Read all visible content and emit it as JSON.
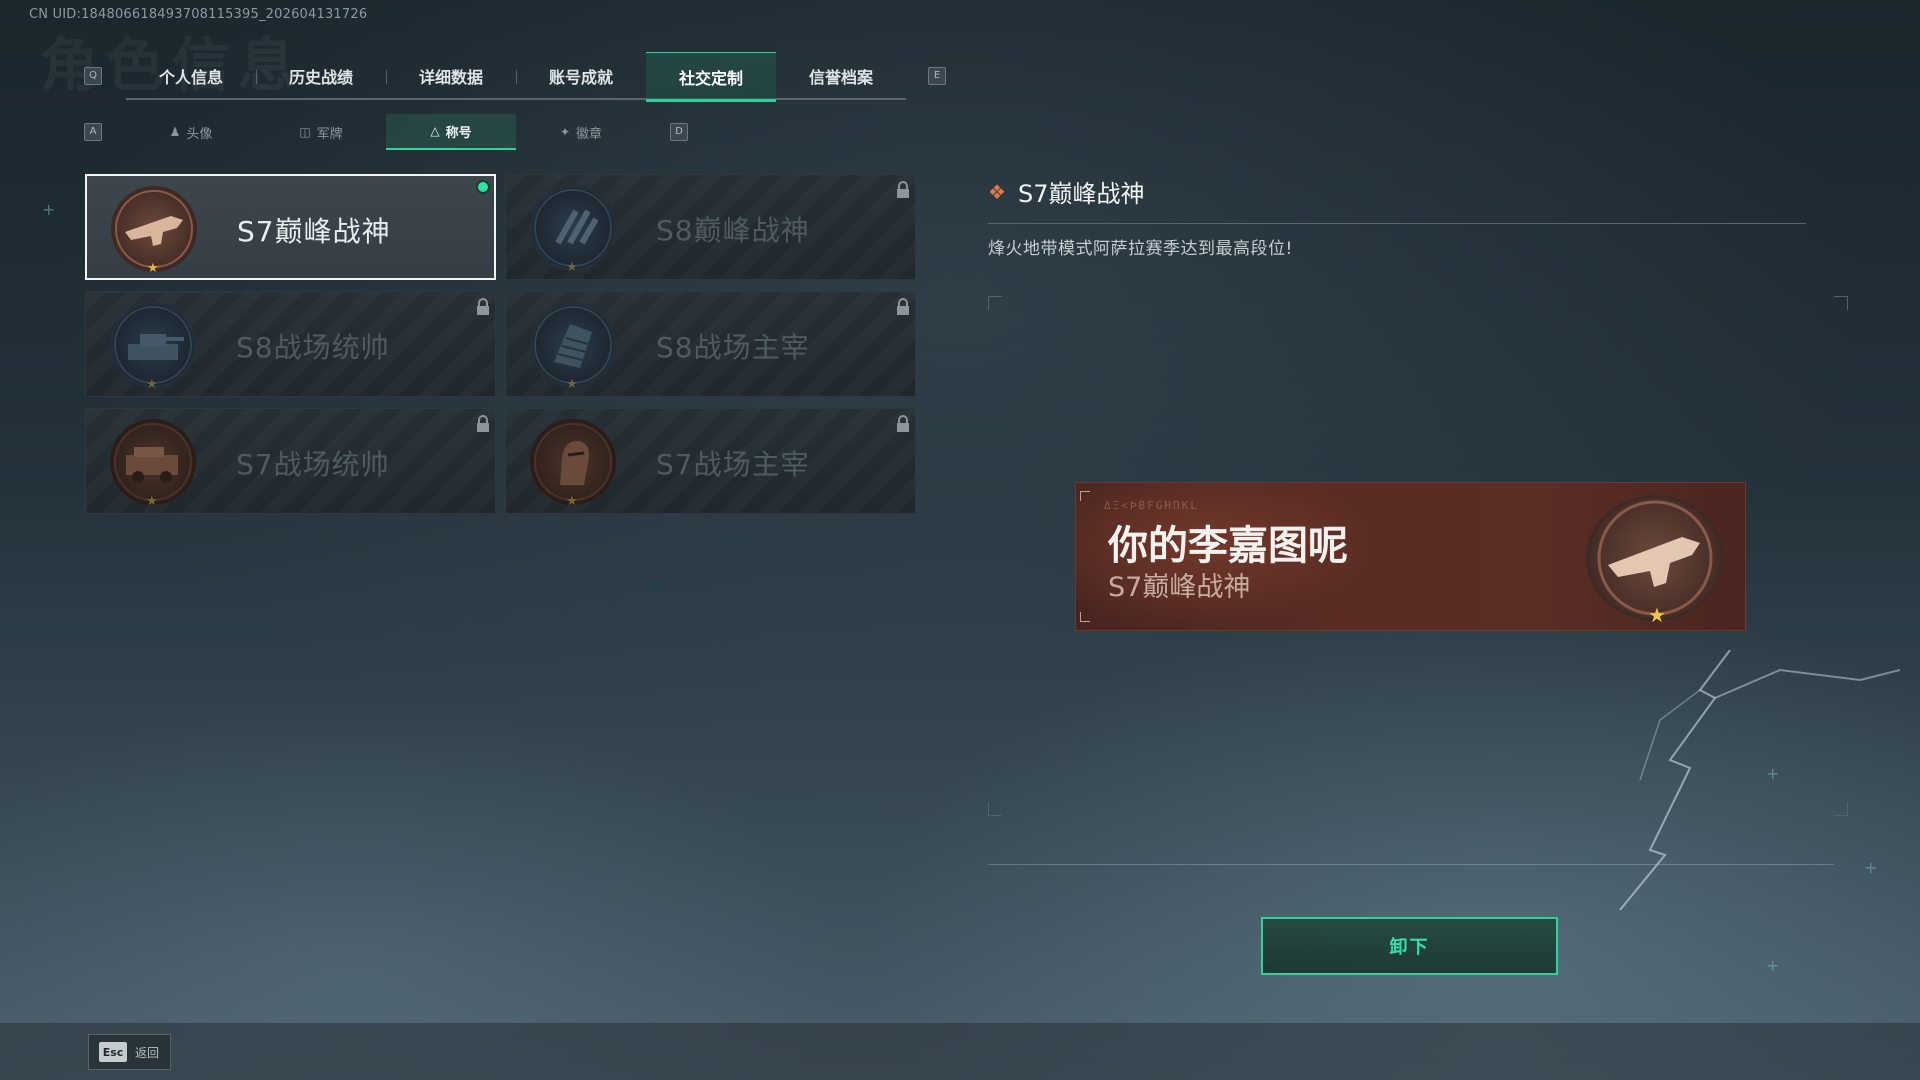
{
  "uid": "CN UID:18480661849370811539​5_202604131726",
  "tabs": {
    "left_key": "Q",
    "right_key": "E",
    "items": [
      "个人信息",
      "历史战绩",
      "详细数据",
      "账号成就",
      "社交定制",
      "信誉档案"
    ],
    "active": "社交定制"
  },
  "subtabs": {
    "left_key": "A",
    "right_key": "D",
    "items": [
      {
        "label": "头像",
        "icon": "person-icon"
      },
      {
        "label": "军牌",
        "icon": "dogtag-icon"
      },
      {
        "label": "称号",
        "icon": "title-icon"
      },
      {
        "label": "徽章",
        "icon": "badge-icon"
      }
    ],
    "active": "称号"
  },
  "titles": [
    {
      "name": "S7巅峰战神",
      "equipped": true,
      "locked": false,
      "emblem": "bronze-rifle"
    },
    {
      "name": "S8巅峰战神",
      "equipped": false,
      "locked": true,
      "emblem": "dark-stripes"
    },
    {
      "name": "S8战场统帅",
      "equipped": false,
      "locked": true,
      "emblem": "dark-tank"
    },
    {
      "name": "S8战场主宰",
      "equipped": false,
      "locked": true,
      "emblem": "dark-building"
    },
    {
      "name": "S7战场统帅",
      "equipped": false,
      "locked": true,
      "emblem": "brown-vehicle"
    },
    {
      "name": "S7战场主宰",
      "equipped": false,
      "locked": true,
      "emblem": "brown-soldier"
    }
  ],
  "detail": {
    "name": "S7巅峰战神",
    "description": "烽火地带模式阿萨拉赛季达到最高段位!",
    "accent": "#e07a45"
  },
  "preview": {
    "rune_text": "ΔΞ<ÞBFGHΠKL",
    "player_name": "你的李嘉图呢",
    "title": "S7巅峰战神"
  },
  "actions": {
    "unequip_label": "卸下",
    "esc_key": "Esc",
    "esc_label": "返回"
  },
  "colors": {
    "accent_green": "#2ed39a",
    "equipped_dot": "#2ee3a0",
    "star": "#e3b44a"
  }
}
